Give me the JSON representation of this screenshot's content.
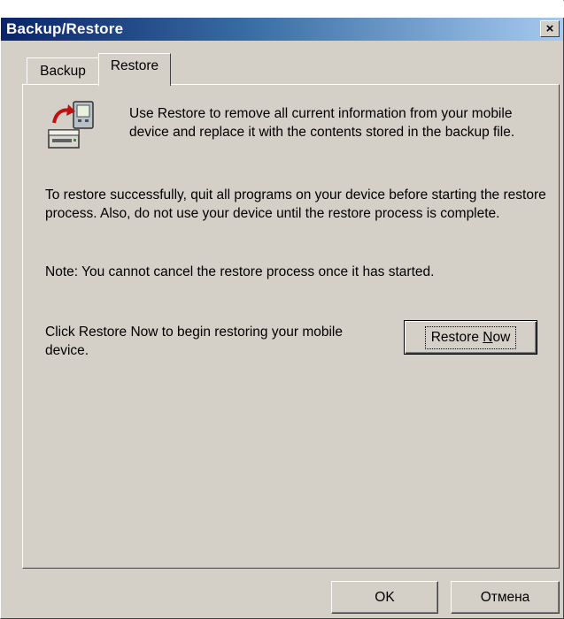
{
  "window": {
    "title": "Backup/Restore",
    "close_glyph": "×"
  },
  "tabs": [
    {
      "label": "Backup",
      "selected": false
    },
    {
      "label": "Restore",
      "selected": true
    }
  ],
  "restore": {
    "icon": "device-restore-icon",
    "intro": "Use Restore to remove all current information from your mobile device and replace it with the contents stored in the backup file.",
    "instructions": "To restore successfully, quit all programs on your device before starting the restore process. Also, do not use your device until the restore process is complete.",
    "note": "Note: You cannot cancel the restore process once it has started.",
    "click_text": "Click Restore Now to begin restoring your mobile device.",
    "restore_now_prefix": "Restore ",
    "restore_now_accel": "N",
    "restore_now_suffix": "ow"
  },
  "buttons": {
    "ok": "OK",
    "cancel": "Отмена"
  },
  "colors": {
    "face": "#d4d0c8",
    "title_start": "#0a246a",
    "title_end": "#a6caf0"
  }
}
